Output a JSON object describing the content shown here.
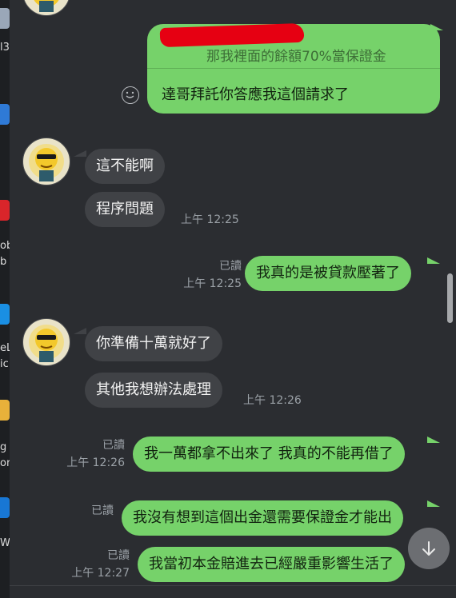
{
  "desktop": {
    "fragments": [
      "l3",
      "ob",
      "b",
      "eL",
      "ic",
      "g",
      "or",
      "W"
    ]
  },
  "chat": {
    "reply": {
      "quoted_text": "那我裡面的餘額70%當保證金",
      "message": "達哥拜託你答應我這個請求了"
    },
    "messages": [
      {
        "dir": "in",
        "text": "這不能啊"
      },
      {
        "dir": "in",
        "text": "程序問題",
        "time": "上午 12:25"
      },
      {
        "dir": "out",
        "text": "我真的是被貸款壓著了",
        "read": "已讀",
        "time": "上午 12:25"
      },
      {
        "dir": "in",
        "text": "你準備十萬就好了"
      },
      {
        "dir": "in",
        "text": "其他我想辦法處理",
        "time": "上午 12:26"
      },
      {
        "dir": "out",
        "text": "我一萬都拿不出來了 我真的不能再借了",
        "read": "已讀",
        "time": "上午 12:26"
      },
      {
        "dir": "out",
        "text": "我沒有想到這個出金還需要保證金才能出",
        "read": "已讀"
      },
      {
        "dir": "out",
        "text": "我當初本金賠進去已經嚴重影響生活了",
        "read": "已讀",
        "time": "上午 12:27"
      }
    ]
  },
  "colors": {
    "background": "#2b2d31",
    "incoming_bubble": "#404246",
    "outgoing_bubble": "#76d26a",
    "meta_text": "#9aa0a6",
    "redaction": "#e60012"
  },
  "icons": {
    "emoji": "smiley-icon",
    "scroll_down": "arrow-down-icon",
    "avatar": "cartoon-avatar"
  }
}
